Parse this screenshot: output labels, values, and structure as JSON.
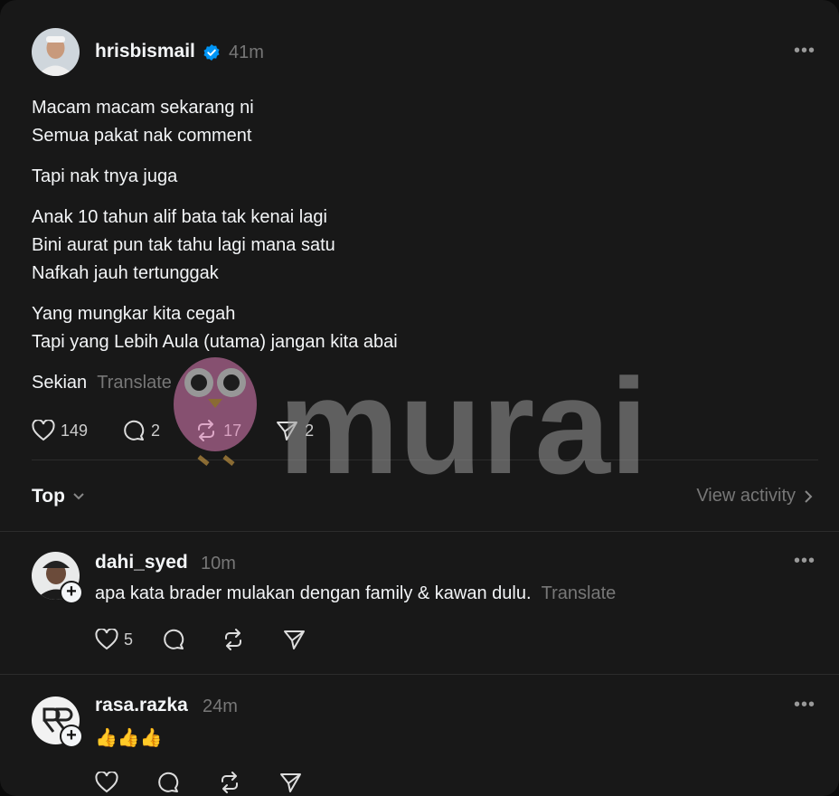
{
  "main_post": {
    "username": "hrisbismail",
    "verified": true,
    "time": "41m",
    "lines": [
      [
        "Macam macam sekarang ni",
        "Semua pakat nak comment"
      ],
      [
        "Tapi nak tnya juga"
      ],
      [
        "Anak 10 tahun alif bata tak kenai lagi",
        "Bini aurat pun tak tahu lagi mana satu",
        "Nafkah jauh tertunggak"
      ],
      [
        "Yang mungkar kita cegah",
        "Tapi yang Lebih Aula (utama) jangan kita abai"
      ]
    ],
    "last_line": "Sekian",
    "translate_label": "Translate",
    "likes": "149",
    "comments": "2",
    "reposts": "17",
    "shares": "2"
  },
  "sort_bar": {
    "sort_label": "Top",
    "activity_label": "View activity"
  },
  "replies": [
    {
      "username": "dahi_syed",
      "time": "10m",
      "text": "apa kata brader mulakan dengan family & kawan dulu.",
      "translate_label": "Translate",
      "likes": "5"
    },
    {
      "username": "rasa.razka",
      "time": "24m",
      "text": "👍👍👍"
    }
  ],
  "watermark": "murai",
  "colors": {
    "verified": "#0095f6",
    "muted": "#777777",
    "background": "#181818"
  }
}
